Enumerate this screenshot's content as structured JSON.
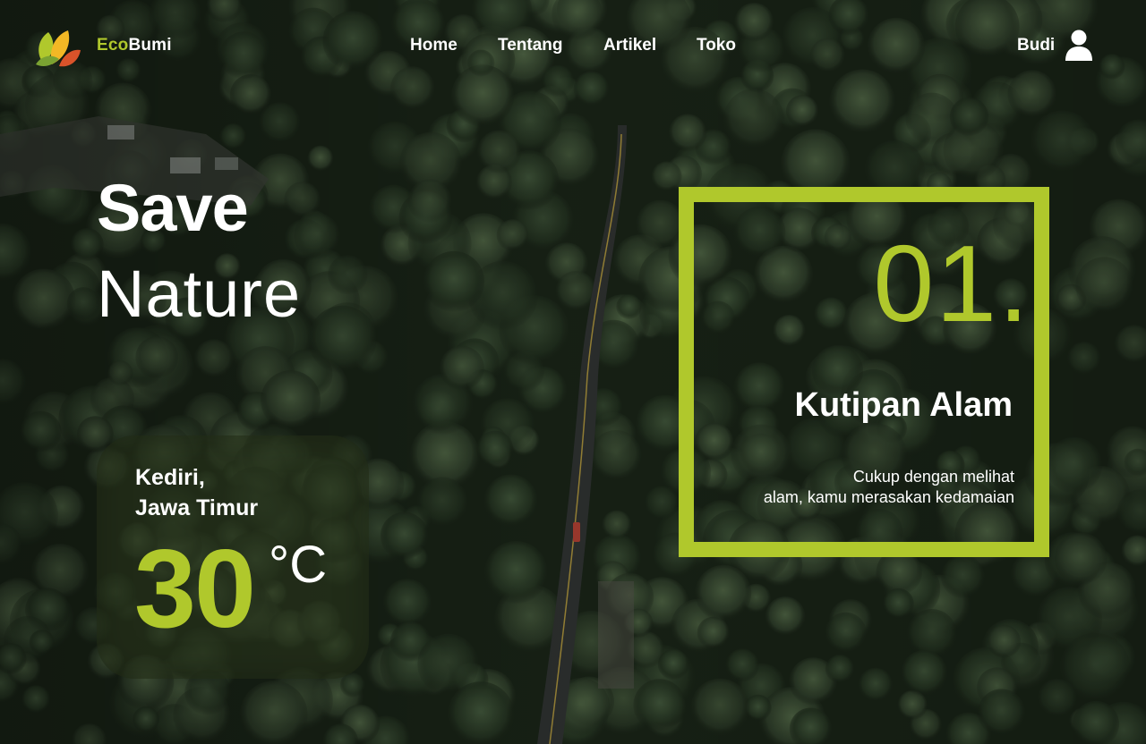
{
  "brand": {
    "eco": "Eco",
    "bumi": "Bumi"
  },
  "nav": {
    "items": [
      {
        "label": "Home"
      },
      {
        "label": "Tentang"
      },
      {
        "label": "Artikel"
      },
      {
        "label": "Toko"
      }
    ]
  },
  "user": {
    "name": "Budi",
    "icon": "user-icon"
  },
  "hero": {
    "line1": "Save",
    "line2": "Nature"
  },
  "weather": {
    "city": "Kediri,",
    "region": "Jawa Timur",
    "temperature": "30",
    "unit": "°C"
  },
  "quote": {
    "number": "01.",
    "title": "Kutipan Alam",
    "line1": "Cukup dengan melihat",
    "line2": "alam, kamu merasakan kedamaian"
  },
  "colors": {
    "accent": "#b0c82c",
    "text": "#ffffff",
    "forest": "#1b2619"
  }
}
